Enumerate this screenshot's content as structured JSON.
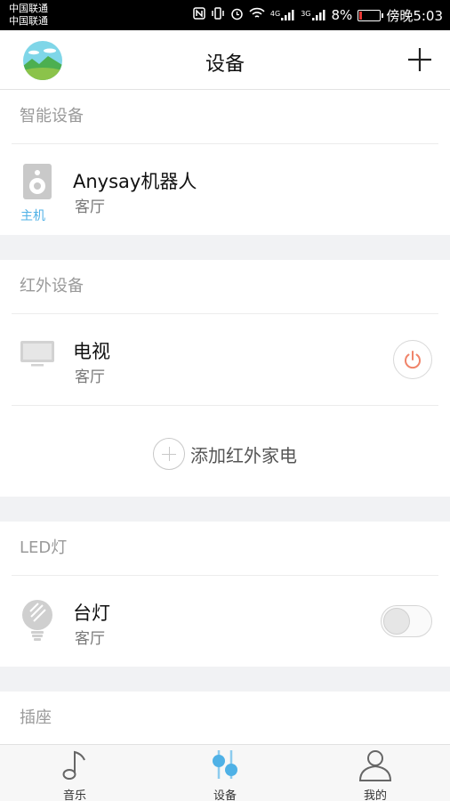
{
  "status_bar": {
    "carrier_1": "中国联通",
    "carrier_2": "中国联通",
    "network_1": "4G",
    "network_2": "3G",
    "battery": "8%",
    "time": "傍晚5:03"
  },
  "header": {
    "title": "设备"
  },
  "sections": {
    "smart": {
      "title": "智能设备",
      "device": {
        "name": "Anysay机器人",
        "room": "客厅",
        "sub_label": "主机"
      }
    },
    "ir": {
      "title": "红外设备",
      "device": {
        "name": "电视",
        "room": "客厅"
      },
      "add_label": "添加红外家电"
    },
    "led": {
      "title": "LED灯",
      "device": {
        "name": "台灯",
        "room": "客厅"
      }
    },
    "socket": {
      "title": "插座"
    }
  },
  "bottom_nav": {
    "music": "音乐",
    "devices": "设备",
    "mine": "我的"
  },
  "colors": {
    "accent": "#4fb1e6",
    "power": "#f0846a",
    "page_bg": "#f1f2f4"
  },
  "icons": [
    "nfc-icon",
    "vibrate-icon",
    "alarm-icon",
    "wifi-icon",
    "signal-icon",
    "battery-icon",
    "avatar-landscape-icon",
    "plus-icon",
    "speaker-icon",
    "tv-icon",
    "power-icon",
    "bulb-icon",
    "music-note-icon",
    "sliders-icon",
    "person-icon"
  ]
}
